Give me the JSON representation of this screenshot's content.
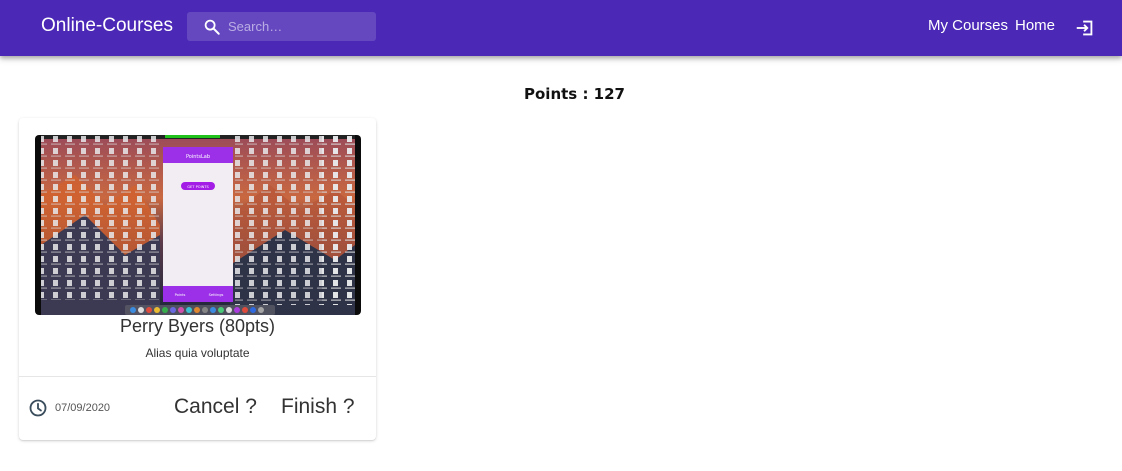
{
  "header": {
    "brand": "Online-Courses",
    "search_placeholder": "Search…",
    "nav": {
      "my_courses": "My Courses",
      "home": "Home"
    },
    "icons": {
      "search": "search-icon",
      "logout": "logout-icon"
    },
    "colors": {
      "appbar": "#4b29b6"
    }
  },
  "main": {
    "points_text": "Points : 127",
    "courses": [
      {
        "title": "Perry Byers (80pts)",
        "description": "Alias quia voluptate",
        "date": "07/09/2020",
        "cancel_label": "Cancel ?",
        "finish_label": "Finish ?",
        "thumbnail": {
          "phone_title": "PointsLab",
          "phone_button": "GET POINTS",
          "phone_footer_left": "Points",
          "phone_footer_right": "Settings"
        }
      }
    ]
  }
}
